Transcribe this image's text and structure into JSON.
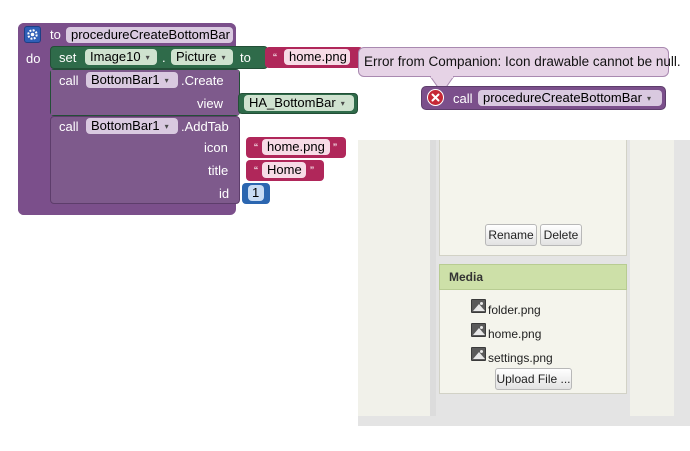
{
  "procedure_block": {
    "keyword_to": "to",
    "name": "procedureCreateBottomBar",
    "keyword_do": "do",
    "color": "#7b4f8b"
  },
  "set_block": {
    "keyword_set": "set",
    "component": "Image10",
    "dot": ".",
    "property": "Picture",
    "keyword_to": "to",
    "value": "home.png",
    "color": "#2f6b4a"
  },
  "create_block": {
    "keyword_call": "call",
    "component": "BottomBar1",
    "method": ".Create",
    "param_view_label": "view",
    "param_view_value": "HA_BottomBar"
  },
  "addtab_block": {
    "keyword_call": "call",
    "component": "BottomBar1",
    "method": ".AddTab",
    "param_icon_label": "icon",
    "param_icon_value": "home.png",
    "param_title_label": "title",
    "param_title_value": "Home",
    "param_id_label": "id",
    "param_id_value": "1"
  },
  "quote_char": "“",
  "quote_close_char": "”",
  "dropdown_arrow": "▾",
  "error_bubble": {
    "message": "Error from Companion: Icon drawable cannot be null."
  },
  "call_block": {
    "keyword_call": "call",
    "name": "procedureCreateBottomBar"
  },
  "project_panel": {
    "rename_label": "Rename",
    "delete_label": "Delete"
  },
  "media_panel": {
    "title": "Media",
    "files": [
      "folder.png",
      "home.png",
      "settings.png"
    ],
    "upload_label": "Upload File ..."
  },
  "colors": {
    "procedure": "#7b4f8b",
    "component": "#2f6b4a",
    "string": "#b0275a",
    "number": "#2b66b0",
    "error": "#c62836",
    "media_header": "#cde0a8"
  }
}
